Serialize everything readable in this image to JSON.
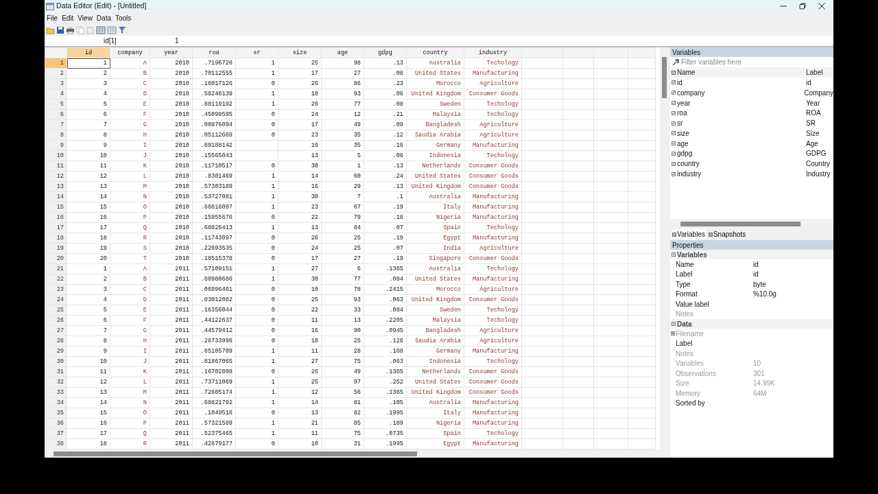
{
  "window": {
    "title": "Data Editor (Edit) - [Untitled]"
  },
  "menu": [
    "File",
    "Edit",
    "View",
    "Data",
    "Tools"
  ],
  "cell_bar": {
    "reference": "id[1]",
    "value": "1"
  },
  "table": {
    "columns": [
      {
        "name": "id",
        "kind": "numeric",
        "selected": true
      },
      {
        "name": "company",
        "kind": "string",
        "selected": false
      },
      {
        "name": "year",
        "kind": "numeric",
        "selected": false
      },
      {
        "name": "roa",
        "kind": "numeric",
        "selected": false
      },
      {
        "name": "sr",
        "kind": "numeric",
        "selected": false
      },
      {
        "name": "size",
        "kind": "numeric",
        "selected": false
      },
      {
        "name": "age",
        "kind": "numeric",
        "selected": false
      },
      {
        "name": "gdpg",
        "kind": "numeric",
        "selected": false
      },
      {
        "name": "country",
        "kind": "string",
        "selected": false
      },
      {
        "name": "industry",
        "kind": "string",
        "selected": false
      }
    ],
    "rows": [
      {
        "number": "1",
        "selected": true,
        "cells": [
          "1",
          "A",
          "2010",
          ".7196726",
          "1",
          "25",
          "98",
          ".13",
          "Australia",
          "Techology"
        ]
      },
      {
        "number": "2",
        "selected": false,
        "cells": [
          "2",
          "B",
          "2010",
          ".70112555",
          "1",
          "17",
          "27",
          ".08",
          "United States",
          "Manufacturing"
        ]
      },
      {
        "number": "3",
        "selected": false,
        "cells": [
          "3",
          "C",
          "2010",
          ".16017126",
          "0",
          "26",
          "86",
          ".23",
          "Morocco",
          "Agriculture"
        ]
      },
      {
        "number": "4",
        "selected": false,
        "cells": [
          "4",
          "D",
          "2010",
          ".58246139",
          "1",
          "10",
          "93",
          ".06",
          "United Kingdom",
          "Consumer Goods"
        ]
      },
      {
        "number": "5",
        "selected": false,
        "cells": [
          "5",
          "E",
          "2010",
          ".88119192",
          "1",
          "26",
          "77",
          ".08",
          "Sweden",
          "Techology"
        ]
      },
      {
        "number": "6",
        "selected": false,
        "cells": [
          "6",
          "F",
          "2010",
          ".45099595",
          "0",
          "24",
          "12",
          ".21",
          "Malaysia",
          "Techology"
        ]
      },
      {
        "number": "7",
        "selected": false,
        "cells": [
          "7",
          "G",
          "2010",
          ".00876094",
          "0",
          "17",
          "49",
          ".09",
          "Bangladesh",
          "Agriculture"
        ]
      },
      {
        "number": "8",
        "selected": false,
        "cells": [
          "8",
          "H",
          "2010",
          ".05112669",
          "0",
          "23",
          "35",
          ".12",
          "Saudia Arabia",
          "Agriculture"
        ]
      },
      {
        "number": "9",
        "selected": false,
        "cells": [
          "9",
          "I",
          "2010",
          ".89188142",
          null,
          "16",
          "35",
          ".16",
          "Germany",
          "Manufacturing"
        ]
      },
      {
        "number": "10",
        "selected": false,
        "cells": [
          "10",
          "J",
          "2010",
          ".15565043",
          null,
          "13",
          "5",
          ".06",
          "Indonesia",
          "Techology"
        ]
      },
      {
        "number": "11",
        "selected": false,
        "cells": [
          "11",
          "K",
          "2010",
          ".11710517",
          "0",
          "30",
          "1",
          ".13",
          "Netherlands",
          "Consumer Goods"
        ]
      },
      {
        "number": "12",
        "selected": false,
        "cells": [
          "12",
          "L",
          "2010",
          ".8301469",
          "1",
          "14",
          "60",
          ".24",
          "United States",
          "Consumer Goods"
        ]
      },
      {
        "number": "13",
        "selected": false,
        "cells": [
          "13",
          "M",
          "2010",
          ".57303189",
          "1",
          "16",
          "29",
          ".13",
          "United Kingdom",
          "Consumer Goods"
        ]
      },
      {
        "number": "14",
        "selected": false,
        "cells": [
          "14",
          "N",
          "2010",
          ".53727081",
          "1",
          "30",
          "7",
          ".1",
          "Australia",
          "Manufacturing"
        ]
      },
      {
        "number": "15",
        "selected": false,
        "cells": [
          "15",
          "O",
          "2010",
          ".66616097",
          "1",
          "23",
          "67",
          ".19",
          "Italy",
          "Manufacturing"
        ]
      },
      {
        "number": "16",
        "selected": false,
        "cells": [
          "16",
          "P",
          "2010",
          ".15955676",
          "0",
          "22",
          "79",
          ".18",
          "Nigeria",
          "Manufacturing"
        ]
      },
      {
        "number": "17",
        "selected": false,
        "cells": [
          "17",
          "Q",
          "2010",
          ".68826413",
          "1",
          "13",
          "84",
          ".07",
          "Spain",
          "Techology"
        ]
      },
      {
        "number": "18",
        "selected": false,
        "cells": [
          "18",
          "R",
          "2010",
          ".11743097",
          "0",
          "26",
          "25",
          ".19",
          "Egypt",
          "Manufacturing"
        ]
      },
      {
        "number": "19",
        "selected": false,
        "cells": [
          "19",
          "S",
          "2010",
          ".22693535",
          "0",
          "24",
          "25",
          ".07",
          "India",
          "Agriculture"
        ]
      },
      {
        "number": "20",
        "selected": false,
        "cells": [
          "20",
          "T",
          "2010",
          ".18515378",
          "0",
          "17",
          "27",
          ".19",
          "Singapore",
          "Consumer Goods"
        ]
      },
      {
        "number": "21",
        "selected": false,
        "cells": [
          "1",
          "A",
          "2011",
          ".57109151",
          "1",
          "27",
          "6",
          ".1365",
          "Australia",
          "Techology"
        ]
      },
      {
        "number": "22",
        "selected": false,
        "cells": [
          "2",
          "B",
          "2011",
          ".60980686",
          "1",
          "30",
          "77",
          ".084",
          "United States",
          "Manufacturing"
        ]
      },
      {
        "number": "23",
        "selected": false,
        "cells": [
          "3",
          "C",
          "2011",
          ".06996461",
          "0",
          "10",
          "78",
          ".2415",
          "Morocco",
          "Agriculture"
        ]
      },
      {
        "number": "24",
        "selected": false,
        "cells": [
          "4",
          "D",
          "2011",
          ".03012082",
          "0",
          "25",
          "93",
          ".063",
          "United Kingdom",
          "Consumer Goods"
        ]
      },
      {
        "number": "25",
        "selected": false,
        "cells": [
          "5",
          "E",
          "2011",
          ".16356044",
          "0",
          "22",
          "33",
          ".084",
          "Sweden",
          "Techology"
        ]
      },
      {
        "number": "26",
        "selected": false,
        "cells": [
          "6",
          "F",
          "2011",
          ".44122637",
          "0",
          "11",
          "13",
          ".2205",
          "Malaysia",
          "Techology"
        ]
      },
      {
        "number": "27",
        "selected": false,
        "cells": [
          "7",
          "G",
          "2011",
          ".44579412",
          "0",
          "16",
          "90",
          ".0945",
          "Bangladesh",
          "Agriculture"
        ]
      },
      {
        "number": "28",
        "selected": false,
        "cells": [
          "8",
          "H",
          "2011",
          ".28733996",
          "0",
          "10",
          "25",
          ".126",
          "Saudia Arabia",
          "Agriculture"
        ]
      },
      {
        "number": "29",
        "selected": false,
        "cells": [
          "9",
          "I",
          "2011",
          ".65105709",
          "1",
          "11",
          "28",
          ".168",
          "Germany",
          "Manufacturing"
        ]
      },
      {
        "number": "30",
        "selected": false,
        "cells": [
          "10",
          "J",
          "2011",
          ".81867065",
          "1",
          "27",
          "75",
          ".063",
          "Indonesia",
          "Techology"
        ]
      },
      {
        "number": "31",
        "selected": false,
        "cells": [
          "11",
          "K",
          "2011",
          ".16702808",
          "0",
          "26",
          "49",
          ".1365",
          "Netherlands",
          "Consumer Goods"
        ]
      },
      {
        "number": "32",
        "selected": false,
        "cells": [
          "12",
          "L",
          "2011",
          ".73711069",
          "1",
          "25",
          "97",
          ".252",
          "United States",
          "Consumer Goods"
        ]
      },
      {
        "number": "33",
        "selected": false,
        "cells": [
          "13",
          "M",
          "2011",
          ".72605174",
          "1",
          "12",
          "56",
          ".1365",
          "United Kingdom",
          "Consumer Goods"
        ]
      },
      {
        "number": "34",
        "selected": false,
        "cells": [
          "14",
          "N",
          "2011",
          ".68821792",
          "1",
          "14",
          "81",
          ".105",
          "Australia",
          "Manufacturing"
        ]
      },
      {
        "number": "35",
        "selected": false,
        "cells": [
          "15",
          "O",
          "2011",
          ".1049516",
          "0",
          "13",
          "82",
          ".1995",
          "Italy",
          "Manufacturing"
        ]
      },
      {
        "number": "36",
        "selected": false,
        "cells": [
          "16",
          "P",
          "2011",
          ".57321589",
          "1",
          "21",
          "85",
          ".189",
          "Nigeria",
          "Manufacturing"
        ]
      },
      {
        "number": "37",
        "selected": false,
        "cells": [
          "17",
          "Q",
          "2011",
          ".52375465",
          "1",
          "11",
          "75",
          ".0735",
          "Spain",
          "Techology"
        ]
      },
      {
        "number": "38",
        "selected": false,
        "cells": [
          "18",
          "R",
          "2011",
          ".42879177",
          "0",
          "10",
          "31",
          ".1995",
          "Egypt",
          "Manufacturing"
        ]
      }
    ]
  },
  "variables_panel": {
    "title": "Variables",
    "filter": {
      "placeholder": "Filter variables here"
    },
    "columns": [
      "Name",
      "Label"
    ],
    "items": [
      {
        "name": "id",
        "label": "id",
        "checked": true
      },
      {
        "name": "company",
        "label": "Company",
        "checked": true
      },
      {
        "name": "year",
        "label": "Year",
        "checked": true
      },
      {
        "name": "roa",
        "label": "ROA",
        "checked": true
      },
      {
        "name": "sr",
        "label": "SR",
        "checked": true
      },
      {
        "name": "size",
        "label": "Size",
        "checked": true
      },
      {
        "name": "age",
        "label": "Age",
        "checked": true
      },
      {
        "name": "gdpg",
        "label": "GDPG",
        "checked": true
      },
      {
        "name": "country",
        "label": "Country",
        "checked": true
      },
      {
        "name": "industry",
        "label": "Industry",
        "checked": true
      }
    ],
    "tabs": [
      {
        "label": "Variables",
        "selected": true
      },
      {
        "label": "Snapshots",
        "selected": false
      }
    ]
  },
  "properties_panel": {
    "title": "Properties",
    "sections": [
      {
        "title": "Variables",
        "expanded": true,
        "rows": [
          {
            "label": "Name",
            "value": "id",
            "disabled": false
          },
          {
            "label": "Label",
            "value": "id",
            "disabled": false
          },
          {
            "label": "Type",
            "value": "byte",
            "disabled": false
          },
          {
            "label": "Format",
            "value": "%10.0g",
            "disabled": false
          },
          {
            "label": "Value label",
            "disabled": false
          },
          {
            "label": "Notes",
            "disabled": true
          }
        ]
      },
      {
        "title": "Data",
        "expanded": true,
        "rows": [
          {
            "label": "Filename",
            "disabled": true,
            "expandable": true
          },
          {
            "label": "Label",
            "disabled": false
          },
          {
            "label": "Notes",
            "disabled": true
          },
          {
            "label": "Variables",
            "value": "10",
            "disabled": true
          },
          {
            "label": "Observations",
            "value": "301",
            "disabled": true
          },
          {
            "label": "Size",
            "value": "14.99K",
            "disabled": true
          },
          {
            "label": "Memory",
            "value": "64M",
            "disabled": true
          },
          {
            "label": "Sorted by",
            "disabled": false
          }
        ]
      }
    ]
  }
}
